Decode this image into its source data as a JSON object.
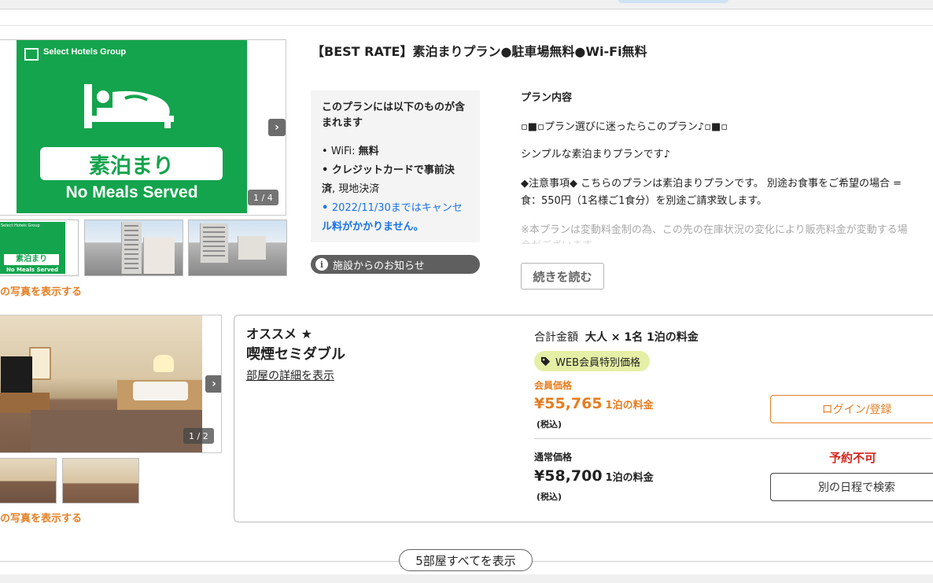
{
  "plan": {
    "title": "【BEST RATE】素泊まりプラン●駐車場無料●Wi-Fi無料",
    "photo": {
      "group_name": "Select Hotels Group",
      "sign_jp": "素泊まり",
      "sign_en": "No Meals Served",
      "thumb_group_name": "Select Hotels Group",
      "counter": "1 / 4",
      "next_glyph": "›"
    },
    "more_photos": "の写真を表示する",
    "includes_heading": "このプランには以下のものが含まれます",
    "includes": {
      "wifi_label": "WiFi: ",
      "wifi_value": "無料",
      "card_line1": "クレジットカードで事前決",
      "card_line2": "済",
      "card_suffix": ", 現地決済",
      "cancel_line1": "2022/11/30まではキャンセ",
      "cancel_line2": "ル料がかかりません。"
    },
    "notice_label": "施設からのお知らせ",
    "body": {
      "heading": "プラン内容",
      "line1": "▫■▫プラン選びに迷ったらこのプラン♪▫■▫",
      "line2": "シンプルな素泊まりプランです♪",
      "line3": "◆注意事項◆ こちらのプランは素泊まりプランです。 別途お食事をご希望の場合 =",
      "line4": "食：550円（1名様ご1食分）を別途ご請求致します。",
      "line5": "※本プランは変動料金制の為、この先の在庫状況の変化により販売料金が変動する場",
      "line6": "合がございます。"
    },
    "read_more": "続きを読む"
  },
  "room": {
    "photo_counter": "1 / 2",
    "next_glyph": "›",
    "more_photos": "の写真を表示する",
    "recommend": "オススメ ★",
    "name": "喫煙セミダブル",
    "detail_link": "部屋の詳細を表示",
    "total_prefix": "合計金額",
    "total_suffix": "大人 × 1名 1泊の料金",
    "web_badge": "WEB会員特別価格",
    "member_label": "会員価格",
    "member_price": "¥55,765",
    "per_night": "1泊の料金",
    "tax_incl": "(税込)",
    "regular_label": "通常価格",
    "regular_price": "¥58,700",
    "login_button": "ログイン/登録",
    "unavailable": "予約不可",
    "other_dates_button": "別の日程で検索"
  },
  "show_all_rooms": "5部屋すべてを表示",
  "colors": {
    "brand_green": "#14a44d",
    "accent_orange": "#e67e22",
    "alert_red": "#d7261e",
    "link_blue": "#1a73e8",
    "badge_yellow": "#e6efa6"
  }
}
